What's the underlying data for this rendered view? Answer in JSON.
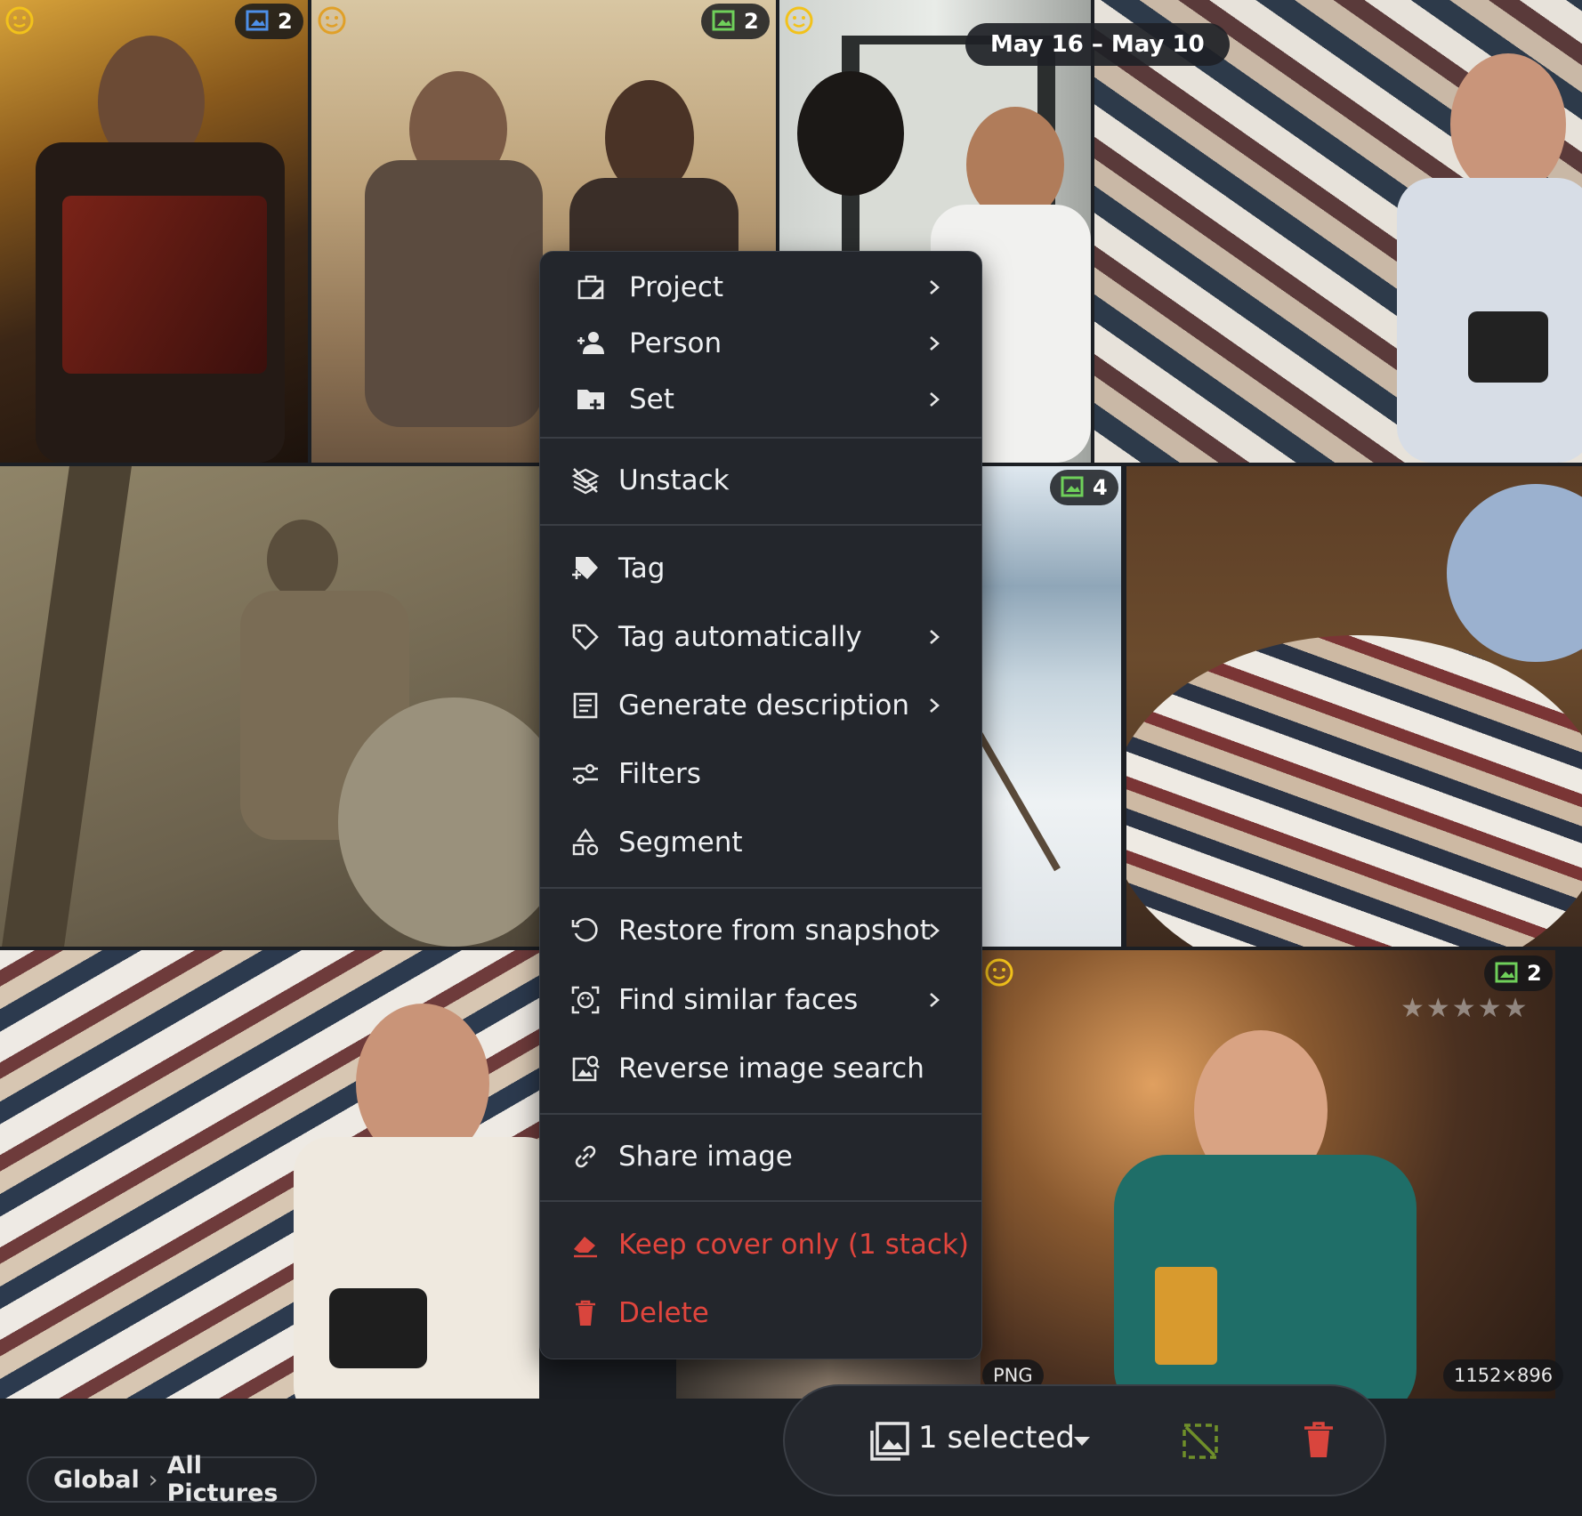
{
  "timeline": {
    "date_range": "May 16 – May 10"
  },
  "tiles": [
    {
      "id": "accordion",
      "stack_count": "2",
      "has_face": true
    },
    {
      "id": "cafe",
      "stack_count": "2",
      "has_face": true
    },
    {
      "id": "two-men",
      "has_face": true
    },
    {
      "id": "photo-wall-man"
    },
    {
      "id": "climber"
    },
    {
      "id": "ski",
      "stack_count": "4"
    },
    {
      "id": "photo-pile"
    },
    {
      "id": "photo-wall-closeup"
    },
    {
      "id": "bar-woman",
      "stack_count": "2",
      "has_face": true,
      "format": "PNG",
      "dimensions": "1152×896",
      "rating_stars": 0,
      "max_stars": 5
    }
  ],
  "context_menu": {
    "items": [
      {
        "label": "Project",
        "icon": "project-edit-icon",
        "submenu": true
      },
      {
        "label": "Person",
        "icon": "add-person-icon",
        "submenu": true
      },
      {
        "label": "Set",
        "icon": "add-folder-icon",
        "submenu": true
      },
      {
        "label": "Unstack",
        "icon": "unstack-icon",
        "submenu": false
      },
      {
        "label": "Tag",
        "icon": "tag-add-icon",
        "submenu": false
      },
      {
        "label": "Tag automatically",
        "icon": "tag-icon",
        "submenu": true
      },
      {
        "label": "Generate description",
        "icon": "description-icon",
        "submenu": true
      },
      {
        "label": "Filters",
        "icon": "filters-icon",
        "submenu": false
      },
      {
        "label": "Segment",
        "icon": "segment-icon",
        "submenu": false
      },
      {
        "label": "Restore from snapshot",
        "icon": "restore-icon",
        "submenu": true
      },
      {
        "label": "Find similar faces",
        "icon": "face-scan-icon",
        "submenu": true
      },
      {
        "label": "Reverse image search",
        "icon": "image-search-icon",
        "submenu": false
      },
      {
        "label": "Share image",
        "icon": "link-icon",
        "submenu": false
      },
      {
        "label": "Keep cover only (1 stack)",
        "icon": "eraser-icon",
        "submenu": false,
        "danger": true
      },
      {
        "label": "Delete",
        "icon": "trash-icon",
        "submenu": false,
        "danger": true
      }
    ]
  },
  "breadcrumb": {
    "root": "Global",
    "separator": "›",
    "current": "All Pictures"
  },
  "selection_bar": {
    "label": "1 selected"
  },
  "colors": {
    "menu_bg": "#23262c",
    "danger": "#e0453d",
    "accent_green": "#6f8f2a",
    "face_yellow": "#f2c21b"
  }
}
